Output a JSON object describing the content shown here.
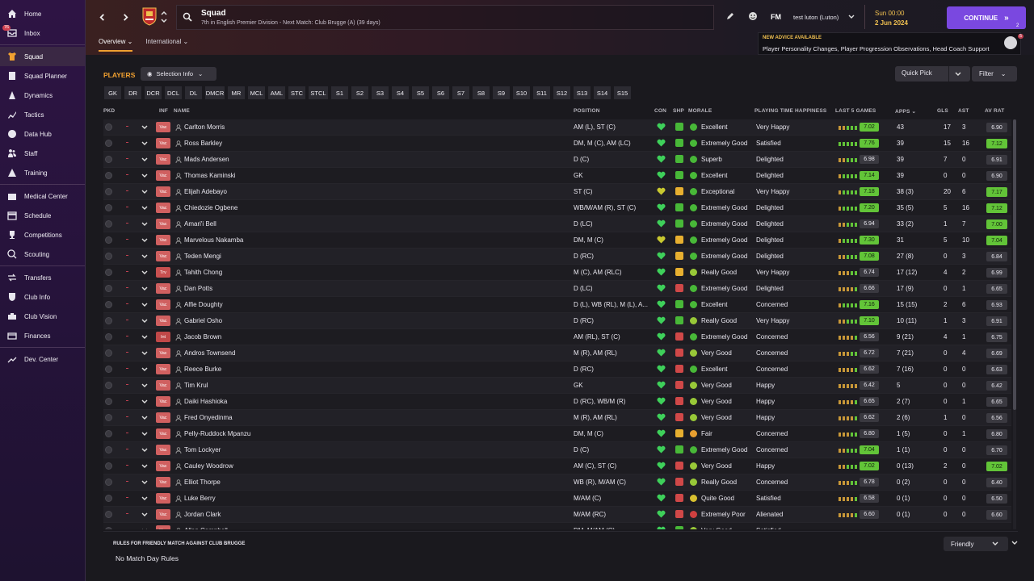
{
  "sidebar": {
    "items": [
      {
        "label": "Home",
        "icon": "home-icon",
        "badge": ""
      },
      {
        "label": "Inbox",
        "icon": "inbox-icon",
        "badge": "76"
      },
      {
        "label": "Squad",
        "icon": "squad-icon",
        "badge": "",
        "active": true
      },
      {
        "label": "Squad Planner",
        "icon": "squad-planner-icon",
        "badge": ""
      },
      {
        "label": "Dynamics",
        "icon": "dynamics-icon",
        "badge": ""
      },
      {
        "label": "Tactics",
        "icon": "tactics-icon",
        "badge": ""
      },
      {
        "label": "Data Hub",
        "icon": "data-hub-icon",
        "badge": ""
      },
      {
        "label": "Staff",
        "icon": "staff-icon",
        "badge": ""
      },
      {
        "label": "Training",
        "icon": "training-icon",
        "badge": ""
      },
      {
        "label": "Medical Center",
        "icon": "medical-icon",
        "badge": ""
      },
      {
        "label": "Schedule",
        "icon": "schedule-icon",
        "badge": ""
      },
      {
        "label": "Competitions",
        "icon": "trophy-icon",
        "badge": ""
      },
      {
        "label": "Scouting",
        "icon": "scouting-icon",
        "badge": ""
      },
      {
        "label": "Transfers",
        "icon": "transfers-icon",
        "badge": ""
      },
      {
        "label": "Club Info",
        "icon": "shield-icon",
        "badge": ""
      },
      {
        "label": "Club Vision",
        "icon": "club-vision-icon",
        "badge": ""
      },
      {
        "label": "Finances",
        "icon": "finances-icon",
        "badge": ""
      },
      {
        "label": "Dev. Center",
        "icon": "dev-center-icon",
        "badge": ""
      }
    ]
  },
  "header": {
    "title": "Squad",
    "subtitle": "7th in English Premier Division - Next Match: Club Brugge (A) (39 days)",
    "fm_logo": "FM",
    "profile": "test luton (Luton)",
    "time": "Sun 00:00",
    "date": "2 Jun 2024",
    "continue_label": "CONTINUE",
    "continue_count": "2",
    "tabs": [
      {
        "label": "Overview",
        "active": true
      },
      {
        "label": "International",
        "active": false
      }
    ]
  },
  "advice": {
    "title": "NEW ADVICE AVAILABLE",
    "text": "Player Personality Changes, Player Progression Observations, Head Coach Support",
    "count": "5"
  },
  "toolbar": {
    "players_label": "PLAYERS",
    "selection_info": "Selection Info",
    "quick_pick": "Quick Pick",
    "filter": "Filter",
    "positions": [
      "GK",
      "DR",
      "DCR",
      "DCL",
      "DL",
      "DMCR",
      "MR",
      "MCL",
      "AML",
      "STC",
      "STCL",
      "S1",
      "S2",
      "S3",
      "S4",
      "S5",
      "S6",
      "S7",
      "S8",
      "S9",
      "S10",
      "S11",
      "S12",
      "S13",
      "S14",
      "S15"
    ]
  },
  "table": {
    "headers": {
      "pkd": "PKD",
      "inf": "INF",
      "name": "NAME",
      "position": "POSITION",
      "con": "CON",
      "shp": "SHP",
      "morale": "MORALE",
      "pt": "PLAYING TIME HAPPINESS",
      "last5": "LAST 5 GAMES",
      "apps": "APPS",
      "gls": "GLS",
      "ast": "AST",
      "avrat": "AV RAT"
    },
    "rows": [
      {
        "inf": "Vac",
        "name": "Carlton Morris",
        "position": "AM (L), ST (C)",
        "morale": "Excellent",
        "pt": "Very Happy",
        "form": "7.02",
        "apps": "43",
        "gls": "17",
        "ast": "3",
        "avrat": "6.90"
      },
      {
        "inf": "Vac",
        "name": "Ross Barkley",
        "position": "DM, M (C), AM (LC)",
        "morale": "Extremely Good",
        "pt": "Satisfied",
        "form": "7.76",
        "apps": "39",
        "gls": "15",
        "ast": "16",
        "avrat": "7.12"
      },
      {
        "inf": "Vac",
        "name": "Mads Andersen",
        "position": "D (C)",
        "morale": "Superb",
        "pt": "Delighted",
        "form": "6.98",
        "apps": "39",
        "gls": "7",
        "ast": "0",
        "avrat": "6.91"
      },
      {
        "inf": "Vac",
        "name": "Thomas Kaminski",
        "position": "GK",
        "morale": "Excellent",
        "pt": "Delighted",
        "form": "7.14",
        "apps": "39",
        "gls": "0",
        "ast": "0",
        "avrat": "6.90"
      },
      {
        "inf": "Vac",
        "name": "Elijah Adebayo",
        "position": "ST (C)",
        "morale": "Exceptional",
        "pt": "Very Happy",
        "form": "7.18",
        "apps": "38 (3)",
        "gls": "20",
        "ast": "6",
        "avrat": "7.17"
      },
      {
        "inf": "Vac",
        "name": "Chiedozie Ogbene",
        "position": "WB/M/AM (R), ST (C)",
        "morale": "Extremely Good",
        "pt": "Delighted",
        "form": "7.20",
        "apps": "35 (5)",
        "gls": "5",
        "ast": "16",
        "avrat": "7.12"
      },
      {
        "inf": "Vac",
        "name": "Amari'i Bell",
        "position": "D (LC)",
        "morale": "Extremely Good",
        "pt": "Delighted",
        "form": "6.94",
        "apps": "33 (2)",
        "gls": "1",
        "ast": "7",
        "avrat": "7.00"
      },
      {
        "inf": "Vac",
        "name": "Marvelous Nakamba",
        "position": "DM, M (C)",
        "morale": "Extremely Good",
        "pt": "Delighted",
        "form": "7.30",
        "apps": "31",
        "gls": "5",
        "ast": "10",
        "avrat": "7.04"
      },
      {
        "inf": "Vac",
        "name": "Teden Mengi",
        "position": "D (RC)",
        "morale": "Extremely Good",
        "pt": "Delighted",
        "form": "7.08",
        "apps": "27 (8)",
        "gls": "0",
        "ast": "3",
        "avrat": "6.84"
      },
      {
        "inf": "Trv",
        "name": "Tahith Chong",
        "position": "M (C), AM (RLC)",
        "morale": "Really Good",
        "pt": "Very Happy",
        "form": "6.74",
        "apps": "17 (12)",
        "gls": "4",
        "ast": "2",
        "avrat": "6.99"
      },
      {
        "inf": "Vac",
        "name": "Dan Potts",
        "position": "D (LC)",
        "morale": "Extremely Good",
        "pt": "Delighted",
        "form": "6.66",
        "apps": "17 (9)",
        "gls": "0",
        "ast": "1",
        "avrat": "6.65"
      },
      {
        "inf": "Vac",
        "name": "Alfie Doughty",
        "position": "D (L), WB (RL), M (L), A...",
        "morale": "Excellent",
        "pt": "Concerned",
        "form": "7.16",
        "apps": "15 (15)",
        "gls": "2",
        "ast": "6",
        "avrat": "6.93"
      },
      {
        "inf": "Vac",
        "name": "Gabriel Osho",
        "position": "D (RC)",
        "morale": "Really Good",
        "pt": "Very Happy",
        "form": "7.10",
        "apps": "10 (11)",
        "gls": "1",
        "ast": "3",
        "avrat": "6.91"
      },
      {
        "inf": "Int",
        "name": "Jacob Brown",
        "position": "AM (RL), ST (C)",
        "morale": "Extremely Good",
        "pt": "Concerned",
        "form": "6.56",
        "apps": "9 (21)",
        "gls": "4",
        "ast": "1",
        "avrat": "6.75"
      },
      {
        "inf": "Vac",
        "name": "Andros Townsend",
        "position": "M (R), AM (RL)",
        "morale": "Very Good",
        "pt": "Concerned",
        "form": "6.72",
        "apps": "7 (21)",
        "gls": "0",
        "ast": "4",
        "avrat": "6.69"
      },
      {
        "inf": "Vac",
        "name": "Reece Burke",
        "position": "D (RC)",
        "morale": "Excellent",
        "pt": "Concerned",
        "form": "6.62",
        "apps": "7 (16)",
        "gls": "0",
        "ast": "0",
        "avrat": "6.63"
      },
      {
        "inf": "Vac",
        "name": "Tim Krul",
        "position": "GK",
        "morale": "Very Good",
        "pt": "Happy",
        "form": "6.42",
        "apps": "5",
        "gls": "0",
        "ast": "0",
        "avrat": "6.42"
      },
      {
        "inf": "Vac",
        "name": "Daiki Hashioka",
        "position": "D (RC), WB/M (R)",
        "morale": "Very Good",
        "pt": "Happy",
        "form": "6.65",
        "apps": "2 (7)",
        "gls": "0",
        "ast": "1",
        "avrat": "6.65"
      },
      {
        "inf": "Vac",
        "name": "Fred Onyedinma",
        "position": "M (R), AM (RL)",
        "morale": "Very Good",
        "pt": "Happy",
        "form": "6.62",
        "apps": "2 (6)",
        "gls": "1",
        "ast": "0",
        "avrat": "6.56"
      },
      {
        "inf": "Vac",
        "name": "Pelly-Ruddock Mpanzu",
        "position": "DM, M (C)",
        "morale": "Fair",
        "pt": "Concerned",
        "form": "6.80",
        "apps": "1 (5)",
        "gls": "0",
        "ast": "1",
        "avrat": "6.80"
      },
      {
        "inf": "Vac",
        "name": "Tom Lockyer",
        "position": "D (C)",
        "morale": "Extremely Good",
        "pt": "Concerned",
        "form": "7.04",
        "apps": "1 (1)",
        "gls": "0",
        "ast": "0",
        "avrat": "6.70"
      },
      {
        "inf": "Vac",
        "name": "Cauley Woodrow",
        "position": "AM (C), ST (C)",
        "morale": "Very Good",
        "pt": "Happy",
        "form": "7.02",
        "apps": "0 (13)",
        "gls": "2",
        "ast": "0",
        "avrat": "7.02"
      },
      {
        "inf": "Vac",
        "name": "Elliot Thorpe",
        "position": "WB (R), M/AM (C)",
        "morale": "Really Good",
        "pt": "Concerned",
        "form": "6.78",
        "apps": "0 (2)",
        "gls": "0",
        "ast": "0",
        "avrat": "6.40"
      },
      {
        "inf": "Vac",
        "name": "Luke Berry",
        "position": "M/AM (C)",
        "morale": "Quite Good",
        "pt": "Satisfied",
        "form": "6.58",
        "apps": "0 (1)",
        "gls": "0",
        "ast": "0",
        "avrat": "6.50"
      },
      {
        "inf": "Vac",
        "name": "Jordan Clark",
        "position": "M/AM (RC)",
        "morale": "Extremely Poor",
        "pt": "Alienated",
        "form": "6.60",
        "apps": "0 (1)",
        "gls": "0",
        "ast": "0",
        "avrat": "6.60"
      },
      {
        "inf": "Vac",
        "name": "Allan Campbell",
        "position": "DM, M/AM (C)",
        "morale": "Very Good",
        "pt": "Satisfied",
        "form": "",
        "apps": "",
        "gls": "",
        "ast": "",
        "avrat": ""
      }
    ]
  },
  "rules": {
    "title": "RULES FOR FRIENDLY MATCH AGAINST CLUB BRUGGE",
    "text": "No Match Day Rules",
    "dropdown": "Friendly"
  },
  "colors": {
    "accent": "#f0a030",
    "continue": "#7a48e0",
    "good": "#62c438",
    "bad": "#d04040"
  }
}
